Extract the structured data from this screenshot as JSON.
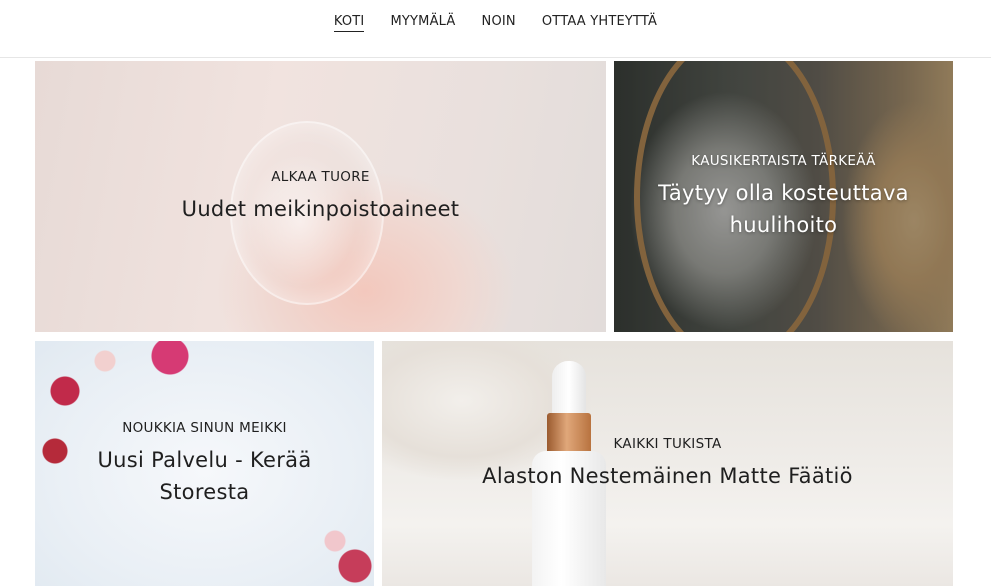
{
  "nav": {
    "items": [
      "KOTI",
      "MYYMÄLÄ",
      "NOIN",
      "OTTAA YHTEYTTÄ"
    ],
    "active_index": 0
  },
  "tiles": [
    {
      "eyebrow": "ALKAA TUORE",
      "headline": "Uudet meikinpoistoaineet",
      "text_color": "#1f1f1f"
    },
    {
      "eyebrow": "KAUSIKERTAISTA TÄRKEÄÄ",
      "headline": "Täytyy olla kosteuttava huulihoito",
      "text_color": "#ffffff"
    },
    {
      "eyebrow": "NOUKKIA SINUN MEIKKI",
      "headline": "Uusi Palvelu - Kerää Storesta",
      "text_color": "#1f1f1f"
    },
    {
      "eyebrow": "KAIKKI TUKISTA",
      "headline": "Alaston Nestemäinen Matte Fäätiö",
      "text_color": "#1f1f1f"
    }
  ]
}
